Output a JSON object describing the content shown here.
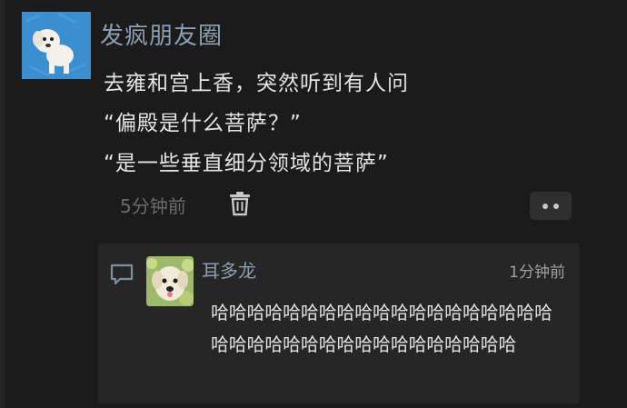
{
  "post": {
    "author": "发疯朋友圈",
    "lines": [
      "去雍和宫上香，突然听到有人问",
      "“偏殿是什么菩萨？”",
      "“是一些垂直细分领域的菩萨”"
    ],
    "time": "5分钟前",
    "avatar_icon": "cartoon-dog-avatar",
    "delete_icon": "trash-icon",
    "more_icon": "more-dots-icon"
  },
  "comment": {
    "author": "耳多龙",
    "time": "1分钟前",
    "text": "哈哈哈哈哈哈哈哈哈哈哈哈哈哈哈哈哈哈哈哈哈哈哈哈哈哈哈哈哈哈哈哈哈哈哈哈",
    "icon": "comment-bubble-icon",
    "avatar_icon": "puppy-photo-avatar"
  },
  "colors": {
    "background": "#1b1b1b",
    "name": "#8b9fb0",
    "panel": "#262626"
  }
}
